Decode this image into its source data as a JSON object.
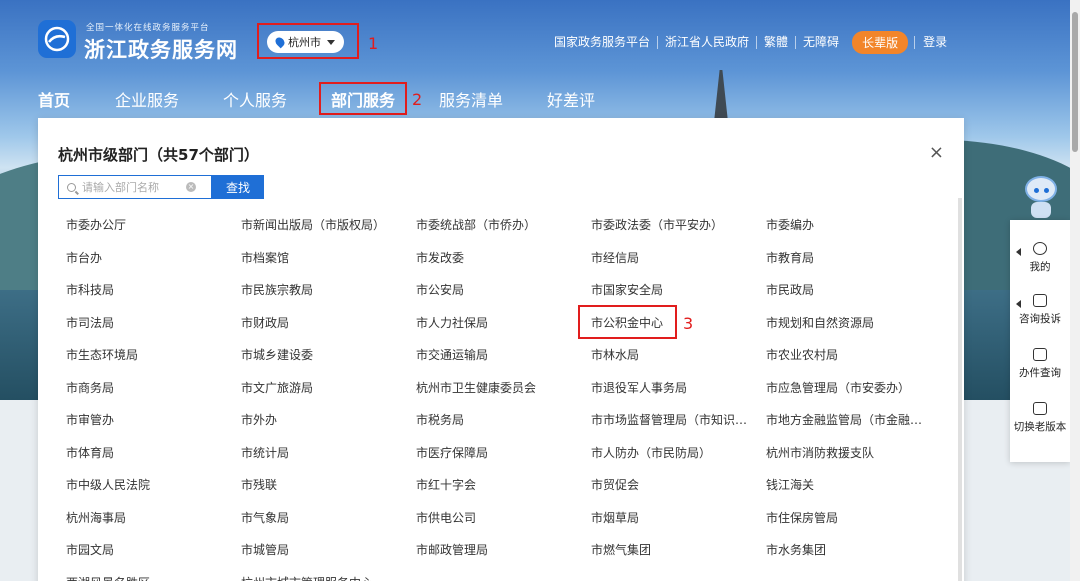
{
  "header": {
    "logo_sub": "全国一体化在线政务服务平台",
    "logo_title": "浙江政务服务网",
    "city": "杭州市",
    "links": [
      "国家政务服务平台",
      "浙江省人民政府",
      "繁體",
      "无障碍"
    ],
    "elder_mode": "长辈版",
    "login": "登录"
  },
  "nav": {
    "items": [
      "首页",
      "企业服务",
      "个人服务",
      "部门服务",
      "服务清单",
      "好差评"
    ]
  },
  "annotations": [
    "1",
    "2",
    "3"
  ],
  "panel": {
    "title": "杭州市级部门（共57个部门）",
    "close": "×",
    "search_placeholder": "请输入部门名称",
    "search_button": "查找",
    "departments": [
      "市委办公厅",
      "市新闻出版局（市版权局）",
      "市委统战部（市侨办）",
      "市委政法委（市平安办）",
      "市委编办",
      "市台办",
      "市档案馆",
      "市发改委",
      "市经信局",
      "市教育局",
      "市科技局",
      "市民族宗教局",
      "市公安局",
      "市国家安全局",
      "市民政局",
      "市司法局",
      "市财政局",
      "市人力社保局",
      "市公积金中心",
      "市规划和自然资源局",
      "市生态环境局",
      "市城乡建设委",
      "市交通运输局",
      "市林水局",
      "市农业农村局",
      "市商务局",
      "市文广旅游局",
      "杭州市卫生健康委员会",
      "市退役军人事务局",
      "市应急管理局（市安委办）",
      "市审管办",
      "市外办",
      "市税务局",
      "市市场监督管理局（市知识产权局）",
      "市地方金融监管局（市金融办）",
      "市体育局",
      "市统计局",
      "市医疗保障局",
      "市人防办（市民防局）",
      "杭州市消防救援支队",
      "市中级人民法院",
      "市残联",
      "市红十字会",
      "市贸促会",
      "钱江海关",
      "杭州海事局",
      "市气象局",
      "市供电公司",
      "市烟草局",
      "市住保房管局",
      "市园文局",
      "市城管局",
      "市邮政管理局",
      "市燃气集团",
      "市水务集团",
      "西湖风景名胜区",
      "杭州市城市管理服务中心"
    ]
  },
  "sidebar": {
    "items": [
      "我的",
      "咨询投诉",
      "办件查询",
      "切换老版本"
    ]
  },
  "colors": {
    "brand_blue": "#1f6fd6",
    "annotation_red": "#e11d1d",
    "elder_orange": "#f2852a"
  }
}
